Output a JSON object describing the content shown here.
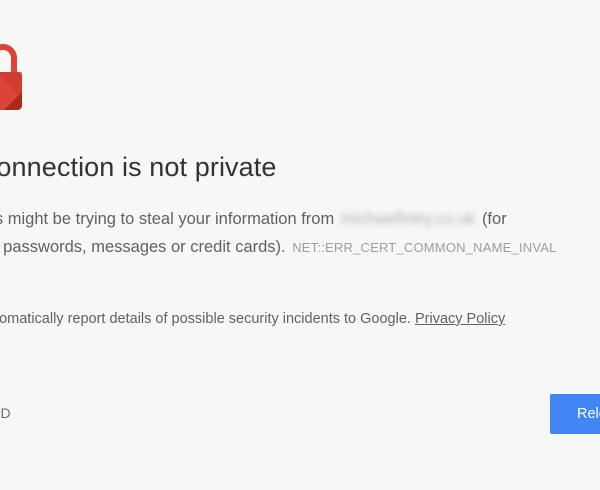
{
  "interstitial": {
    "heading": "ur connection is not private",
    "explanation_line1_prefix": "kers might be trying to steal your information from",
    "domain_blurred": "michaelfoley.co.uk",
    "explanation_line1_suffix": "(for",
    "explanation_line2": "ple, passwords, messages or credit cards).",
    "error_code": "NET::ERR_CERT_COMMON_NAME_INVAL",
    "report_text": "utomatically report details of possible security incidents to Google.",
    "privacy_link": "Privacy Policy",
    "advanced_label": "NCED",
    "reload_label": "Relo"
  },
  "icons": {
    "lock": "lock-icon"
  },
  "colors": {
    "lock_red": "#db4437",
    "lock_dark_red": "#a52714",
    "primary_button": "#4285f4",
    "background": "#f7f7f7"
  }
}
